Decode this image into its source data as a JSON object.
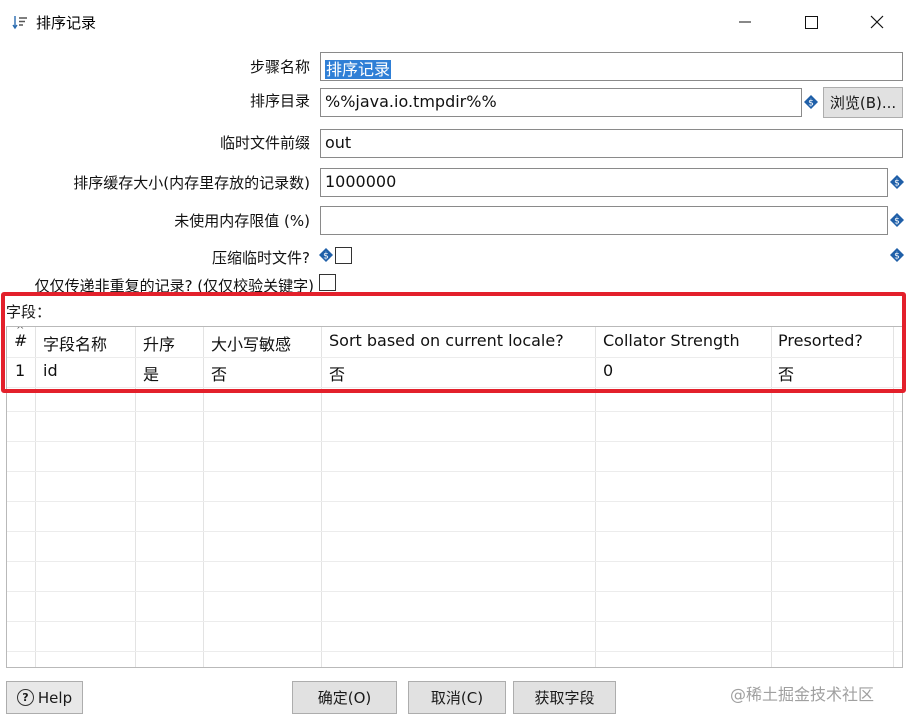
{
  "window": {
    "title": "排序记录",
    "title_icon": "sort-icon",
    "min_glyph": "—",
    "max_glyph": "☐",
    "close_glyph": "✕"
  },
  "form": {
    "step_name_label": "步骤名称",
    "step_name_value": "排序记录",
    "sort_dir_label": "排序目录",
    "sort_dir_value": "%%java.io.tmpdir%%",
    "browse_label": "浏览(B)...",
    "temp_prefix_label": "临时文件前缀",
    "temp_prefix_value": "out",
    "sort_size_label": "排序缓存大小(内存里存放的记录数)",
    "sort_size_value": "1000000",
    "free_memory_label": "未使用内存限值 (%)",
    "free_memory_value": "",
    "compress_label": "压缩临时文件?",
    "compress_checked": false,
    "unique_label": "仅仅传递非重复的记录? (仅仅校验关键字)",
    "unique_checked": false
  },
  "fields": {
    "label": "字段：",
    "columns": [
      "#",
      "字段名称",
      "升序",
      "大小写敏感",
      "Sort based on current locale?",
      "Collator Strength",
      "Presorted?"
    ],
    "rows": [
      [
        "1",
        "id",
        "是",
        "否",
        "否",
        "0",
        "否"
      ]
    ]
  },
  "buttons": {
    "help": "Help",
    "ok": "确定(O)",
    "cancel": "取消(C)",
    "get_fields": "获取字段"
  },
  "watermark": "@稀土掘金技术社区",
  "colors": {
    "highlight_border": "#e3202b",
    "selection": "#2f7fd6",
    "variable_icon": "#1f5fa8"
  }
}
